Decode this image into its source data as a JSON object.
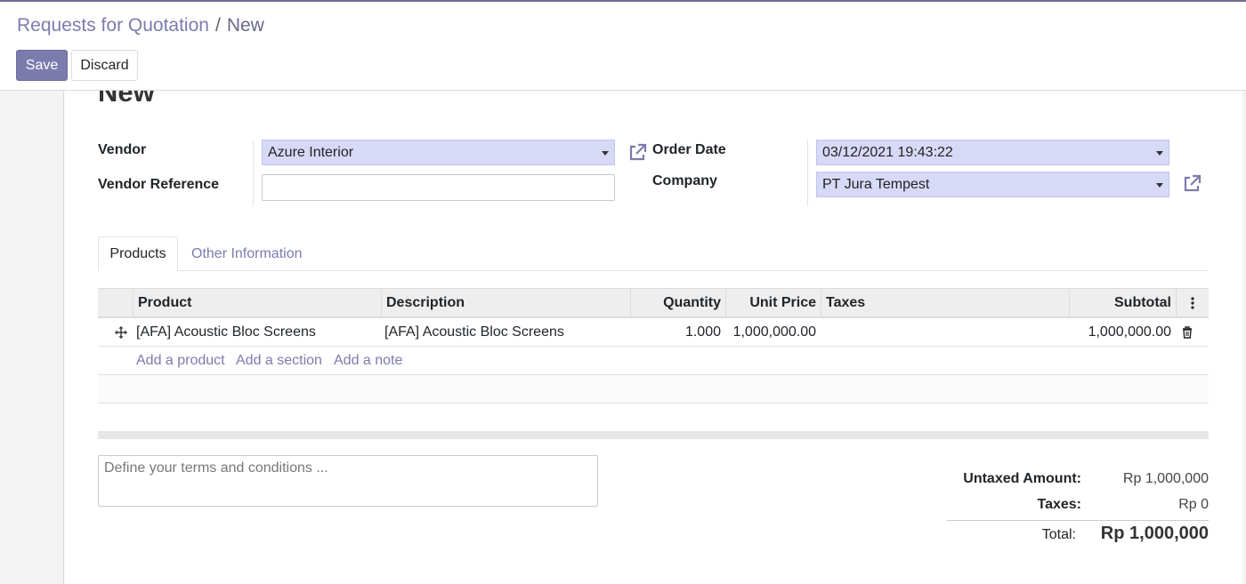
{
  "breadcrumb": {
    "parent": "Requests for Quotation",
    "separator": "/",
    "current": "New"
  },
  "toolbar": {
    "save_label": "Save",
    "discard_label": "Discard"
  },
  "form": {
    "title": "New",
    "vendor": {
      "label": "Vendor",
      "value": "Azure Interior"
    },
    "vendor_reference": {
      "label": "Vendor Reference",
      "value": ""
    },
    "order_date": {
      "label": "Order Date",
      "value": "03/12/2021 19:43:22"
    },
    "company": {
      "label": "Company",
      "value": "PT Jura Tempest"
    }
  },
  "tabs": [
    {
      "label": "Products",
      "active": true
    },
    {
      "label": "Other Information",
      "active": false
    }
  ],
  "table": {
    "columns": {
      "product": "Product",
      "description": "Description",
      "quantity": "Quantity",
      "unit_price": "Unit Price",
      "taxes": "Taxes",
      "subtotal": "Subtotal"
    },
    "rows": [
      {
        "product": "[AFA] Acoustic Bloc Screens",
        "description": "[AFA] Acoustic Bloc Screens",
        "quantity": "1.000",
        "unit_price": "1,000,000.00",
        "taxes": "",
        "subtotal": "1,000,000.00"
      }
    ],
    "actions": {
      "add_product": "Add a product",
      "add_section": "Add a section",
      "add_note": "Add a note"
    }
  },
  "terms": {
    "placeholder": "Define your terms and conditions ..."
  },
  "totals": {
    "untaxed_label": "Untaxed Amount:",
    "untaxed_value": "Rp 1,000,000",
    "taxes_label": "Taxes:",
    "taxes_value": "Rp 0",
    "total_label": "Total:",
    "total_value": "Rp 1,000,000"
  },
  "colors": {
    "accent": "#7c7bad",
    "select_bg": "#d7d9f7"
  },
  "icons": {
    "external_link": "external-link-icon",
    "drag": "drag-handle-icon",
    "delete": "trash-icon",
    "column_options": "vertical-dots-icon"
  }
}
